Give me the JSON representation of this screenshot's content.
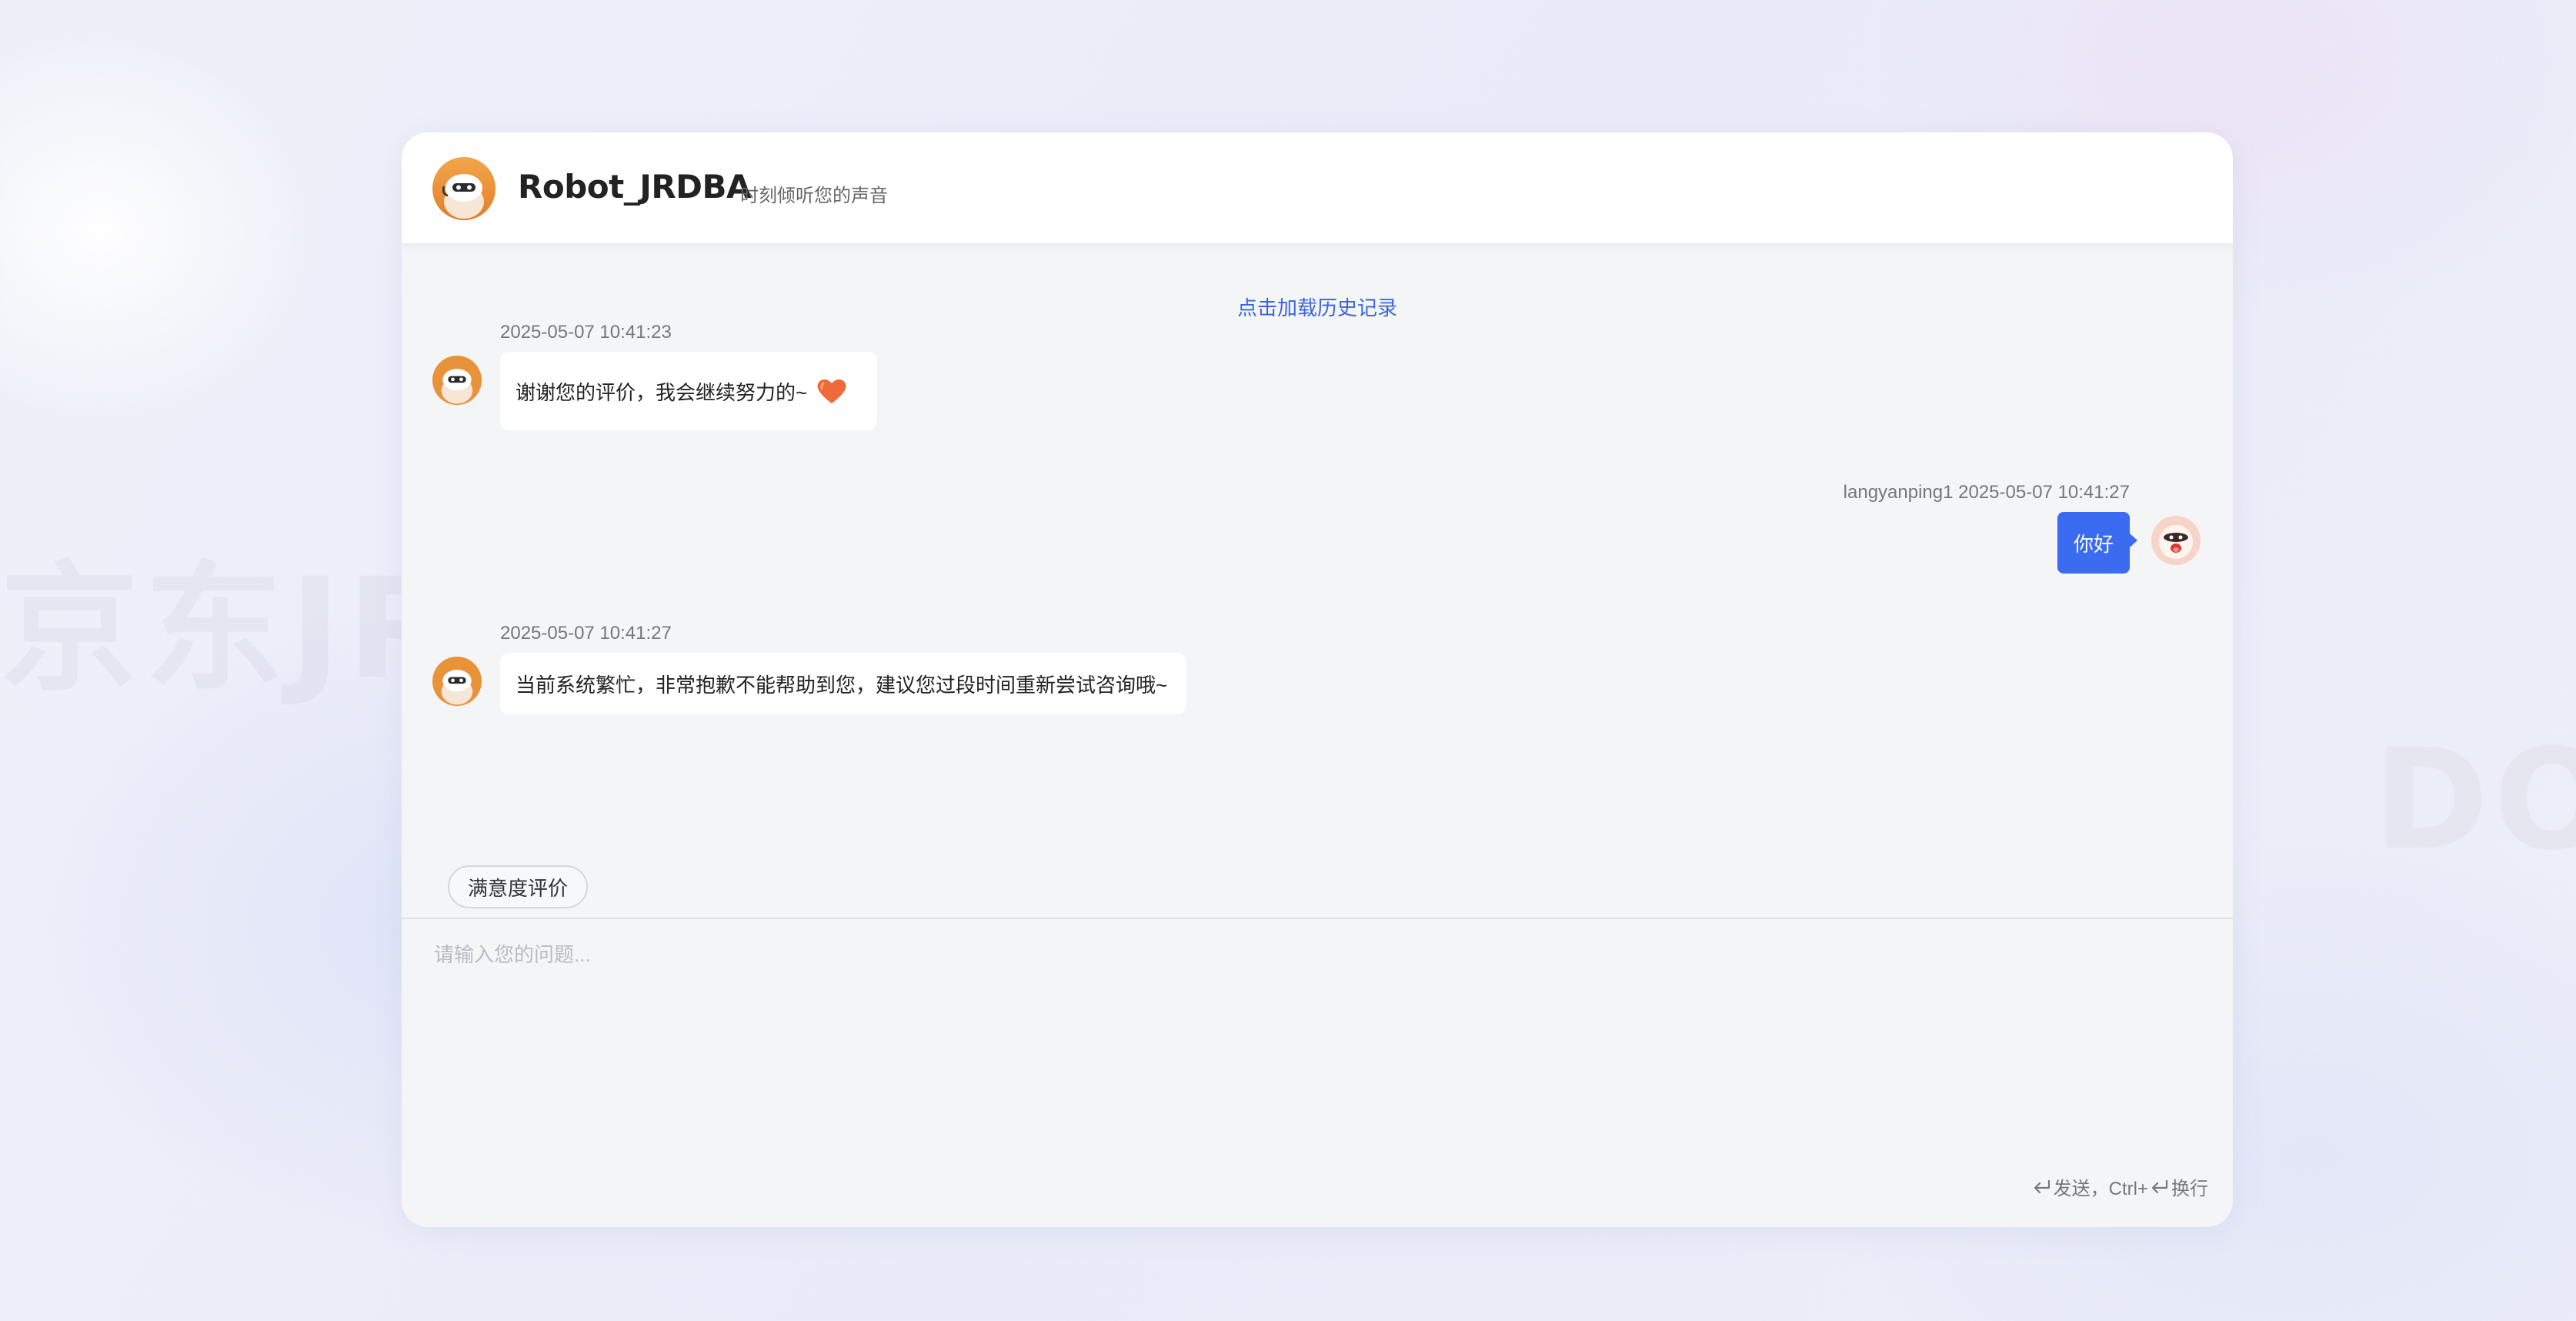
{
  "watermarks": {
    "left": "京东JR",
    "right": "DONG"
  },
  "header": {
    "title": "Robot_JRDBA",
    "subtitle": "时刻倾听您的声音"
  },
  "chat": {
    "history_link": "点击加载历史记录",
    "messages": [
      {
        "sender": "bot",
        "time": "2025-05-07 10:41:23",
        "text": "谢谢您的评价，我会继续努力的~"
      },
      {
        "sender": "user",
        "time": "langyanping1 2025-05-07 10:41:27",
        "text": "你好"
      },
      {
        "sender": "bot",
        "time": "2025-05-07 10:41:27",
        "text": "当前系统繁忙，非常抱歉不能帮助到您，建议您过段时间重新尝试咨询哦~"
      }
    ]
  },
  "rating_button": "满意度评价",
  "input": {
    "placeholder": "请输入您的问题..."
  },
  "hint": {
    "send": "发送，Ctrl+",
    "newline": "换行"
  },
  "colors": {
    "accent": "#3a6bf0",
    "link": "#3b64e0",
    "avatar_orange": "#e8923a",
    "heart": "#ef6a3a"
  },
  "icons": [
    "robot-avatar-icon",
    "user-avatar-icon",
    "heart-icon",
    "enter-key-icon"
  ]
}
